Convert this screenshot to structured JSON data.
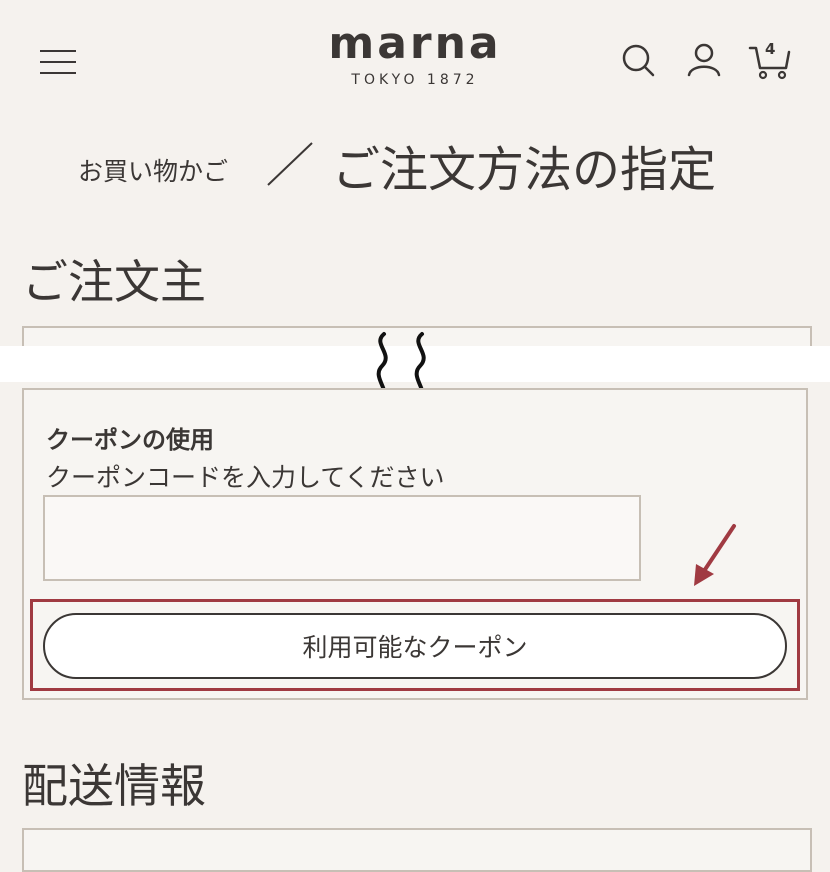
{
  "header": {
    "logo_main": "marna",
    "logo_sub": "TOKYO 1872",
    "cart_count": "4",
    "icons": [
      "menu-icon",
      "search-icon",
      "user-icon",
      "cart-icon"
    ]
  },
  "breadcrumb": {
    "previous": "お買い物かご",
    "current": "ご注文方法の指定"
  },
  "sections": {
    "orderer": "ご注文主",
    "shipping": "配送情報"
  },
  "coupon": {
    "heading": "クーポンの使用",
    "description": "クーポンコードを入力してください",
    "input_value": "",
    "button_label": "利用可能なクーポン"
  },
  "colors": {
    "background": "#f5f2ee",
    "text": "#3b3735",
    "border": "#c7bfb5",
    "highlight": "#a03a42"
  }
}
